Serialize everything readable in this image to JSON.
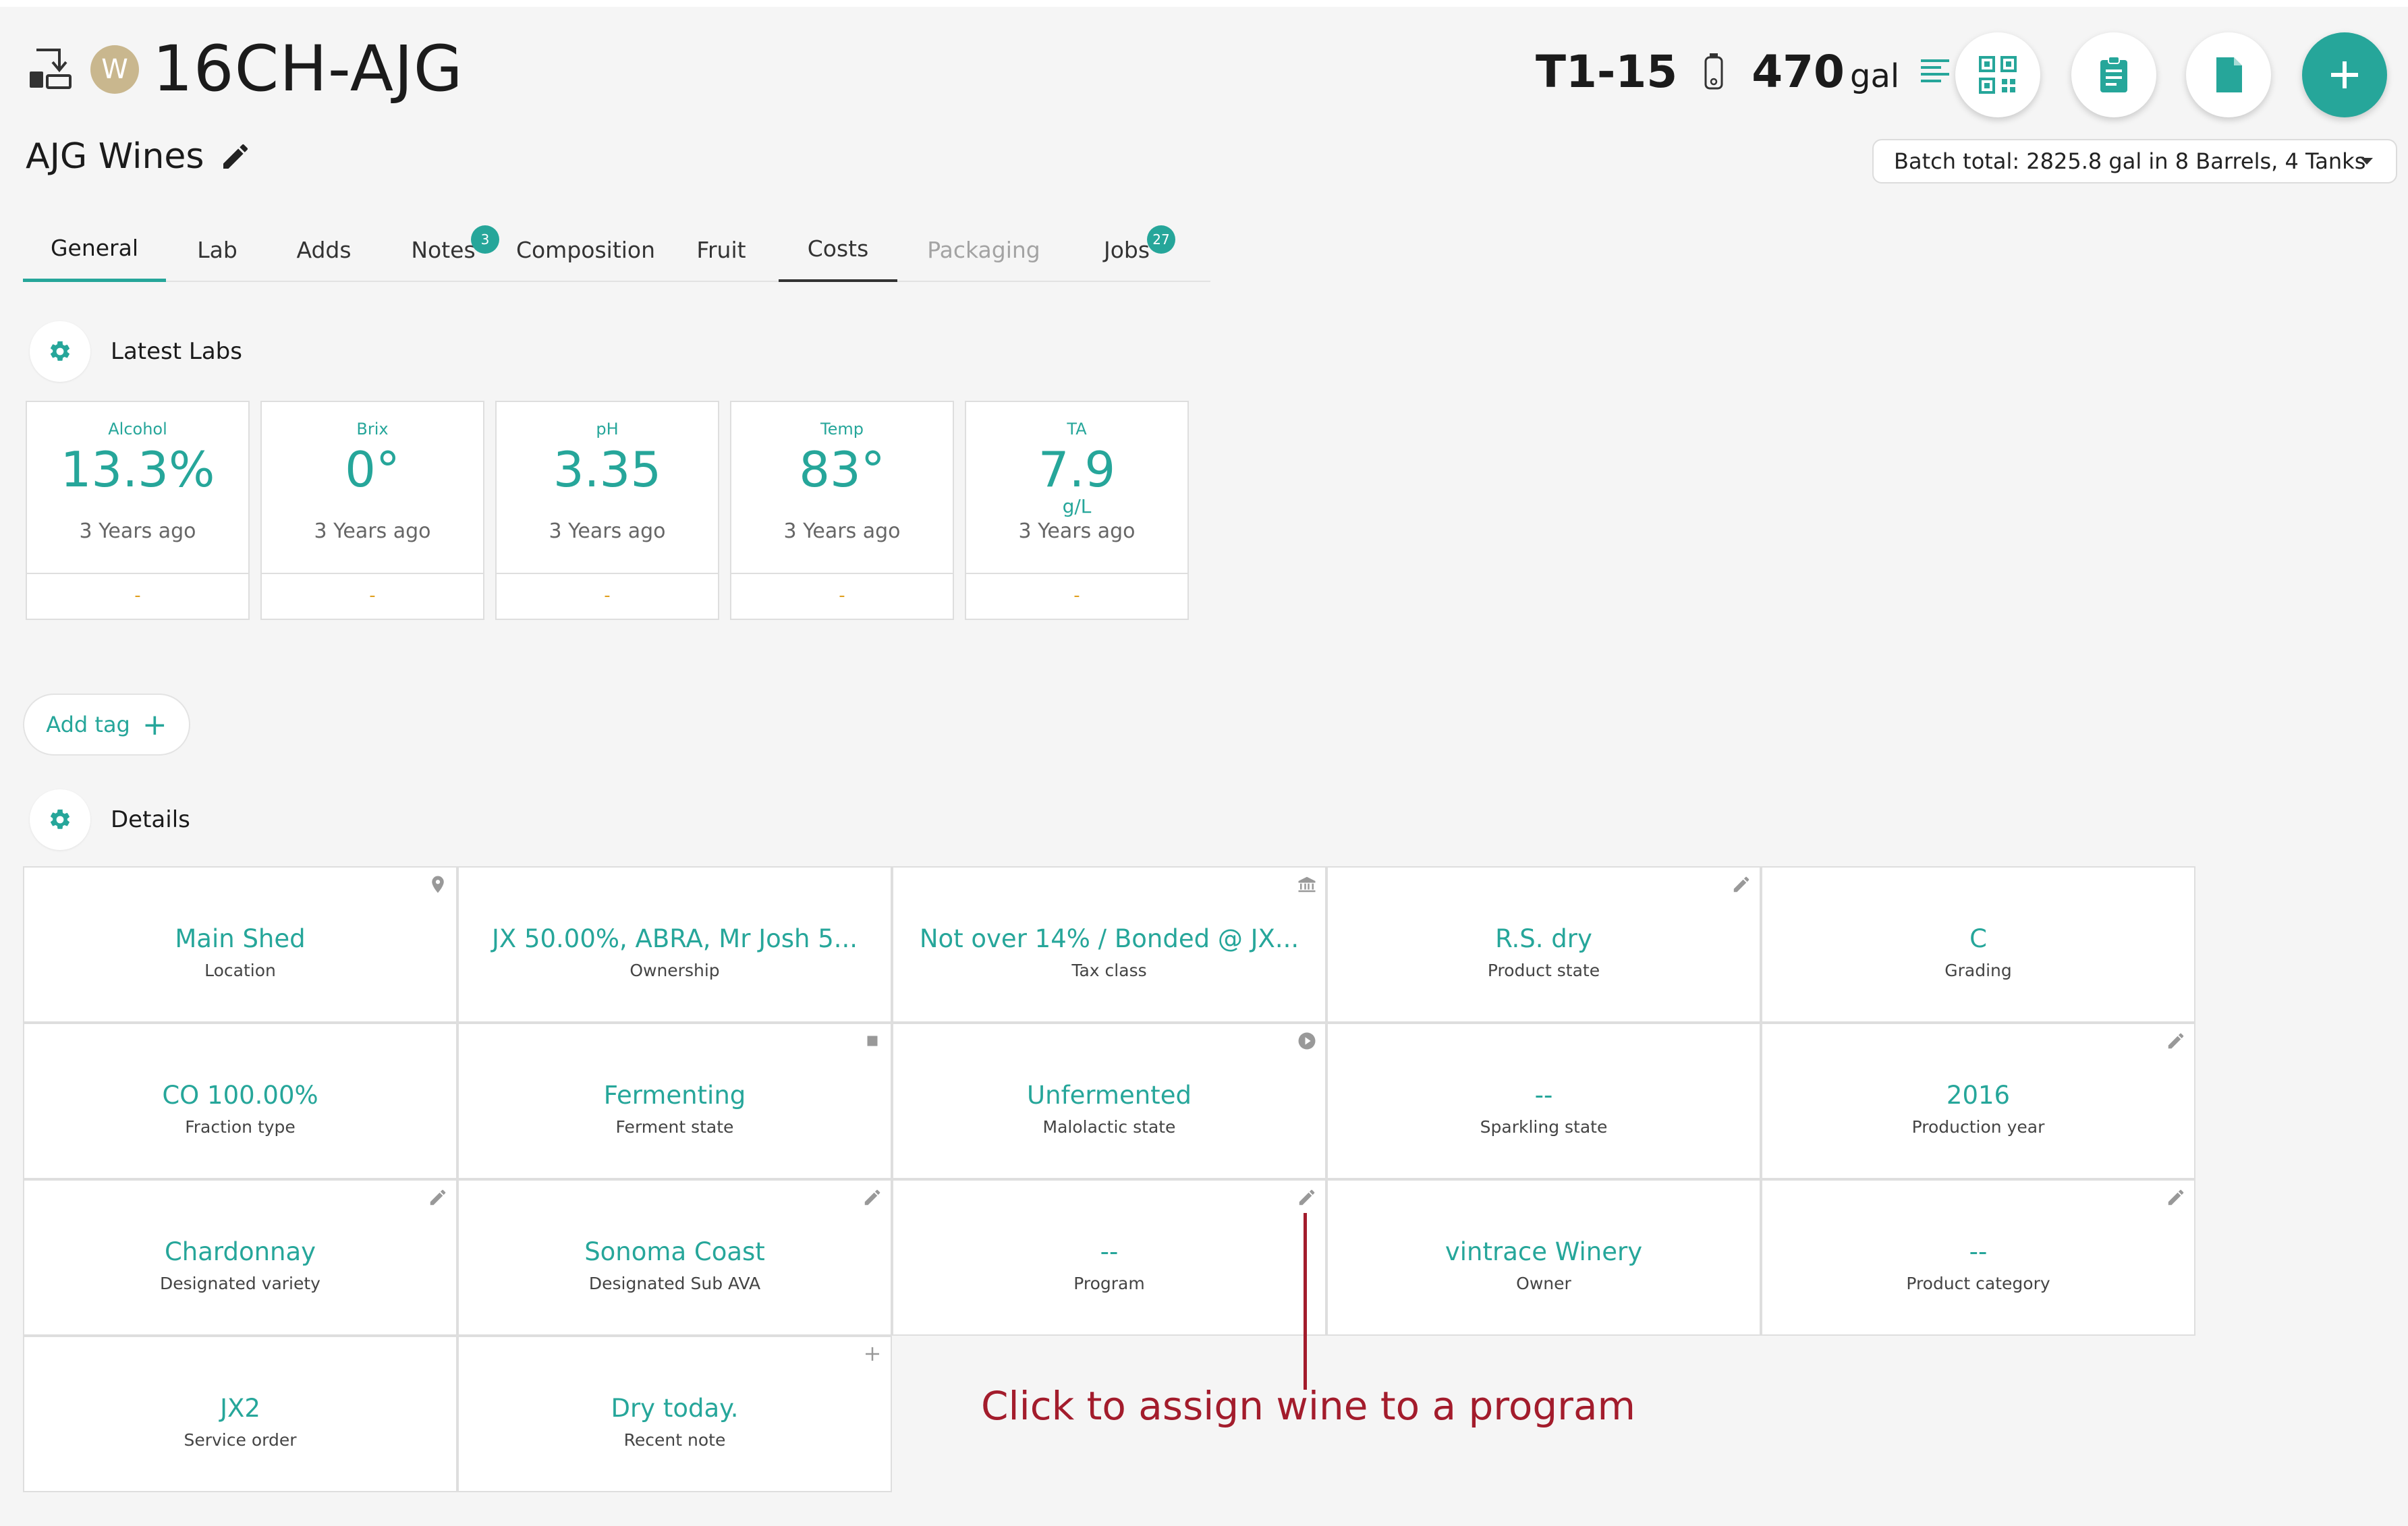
{
  "header": {
    "wine_code": "16CH-AJG",
    "avatar_letter": "W",
    "owner_name": "AJG Wines",
    "vessel_code": "T1-15",
    "volume_value": "470",
    "volume_unit": "gal",
    "batch_total": "Batch total: 2825.8 gal in 8 Barrels, 4 Tanks"
  },
  "tabs": [
    {
      "label": "General"
    },
    {
      "label": "Lab"
    },
    {
      "label": "Adds"
    },
    {
      "label": "Notes",
      "badge": "3"
    },
    {
      "label": "Composition"
    },
    {
      "label": "Fruit"
    },
    {
      "label": "Costs"
    },
    {
      "label": "Packaging"
    },
    {
      "label": "Jobs",
      "badge": "27"
    }
  ],
  "latest_labs": {
    "title": "Latest Labs",
    "cards": [
      {
        "label": "Alcohol",
        "value": "13.3%",
        "unit": "",
        "time": "3 Years ago",
        "footer": "-"
      },
      {
        "label": "Brix",
        "value": "0°",
        "unit": "",
        "time": "3 Years ago",
        "footer": "-"
      },
      {
        "label": "pH",
        "value": "3.35",
        "unit": "",
        "time": "3 Years ago",
        "footer": "-"
      },
      {
        "label": "Temp",
        "value": "83°",
        "unit": "",
        "time": "3 Years ago",
        "footer": "-"
      },
      {
        "label": "TA",
        "value": "7.9",
        "unit": "g/L",
        "time": "3 Years ago",
        "footer": "-"
      }
    ]
  },
  "add_tag_label": "Add tag",
  "add_tag_plus": "+",
  "details": {
    "title": "Details",
    "cells": [
      {
        "value": "Main Shed",
        "label": "Location",
        "icon": "location-pin-icon"
      },
      {
        "value": "JX 50.00%, ABRA, Mr Josh 5...",
        "label": "Ownership",
        "icon": ""
      },
      {
        "value": "Not over 14% / Bonded @ JX...",
        "label": "Tax class",
        "icon": "bank-icon"
      },
      {
        "value": "R.S. dry",
        "label": "Product state",
        "icon": "pencil-icon"
      },
      {
        "value": "C",
        "label": "Grading",
        "icon": ""
      },
      {
        "value": "CO 100.00%",
        "label": "Fraction type",
        "icon": ""
      },
      {
        "value": "Fermenting",
        "label": "Ferment state",
        "icon": "stop-icon"
      },
      {
        "value": "Unfermented",
        "label": "Malolactic state",
        "icon": "play-icon"
      },
      {
        "value": "--",
        "label": "Sparkling state",
        "icon": ""
      },
      {
        "value": "2016",
        "label": "Production year",
        "icon": "pencil-icon"
      },
      {
        "value": "Chardonnay",
        "label": "Designated variety",
        "icon": "pencil-icon"
      },
      {
        "value": "Sonoma Coast",
        "label": "Designated Sub AVA",
        "icon": "pencil-icon"
      },
      {
        "value": "--",
        "label": "Program",
        "icon": "pencil-icon"
      },
      {
        "value": "vintrace Winery",
        "label": "Owner",
        "icon": ""
      },
      {
        "value": "--",
        "label": "Product category",
        "icon": "pencil-icon"
      },
      {
        "value": "JX2",
        "label": "Service order",
        "icon": ""
      },
      {
        "value": "Dry today.",
        "label": "Recent note",
        "icon": "plus-icon"
      }
    ]
  },
  "annotation": {
    "text": "Click to assign wine to a program",
    "color": "#a31c2c"
  },
  "colors": {
    "accent": "#26a69a",
    "background": "#f5f5f5"
  }
}
